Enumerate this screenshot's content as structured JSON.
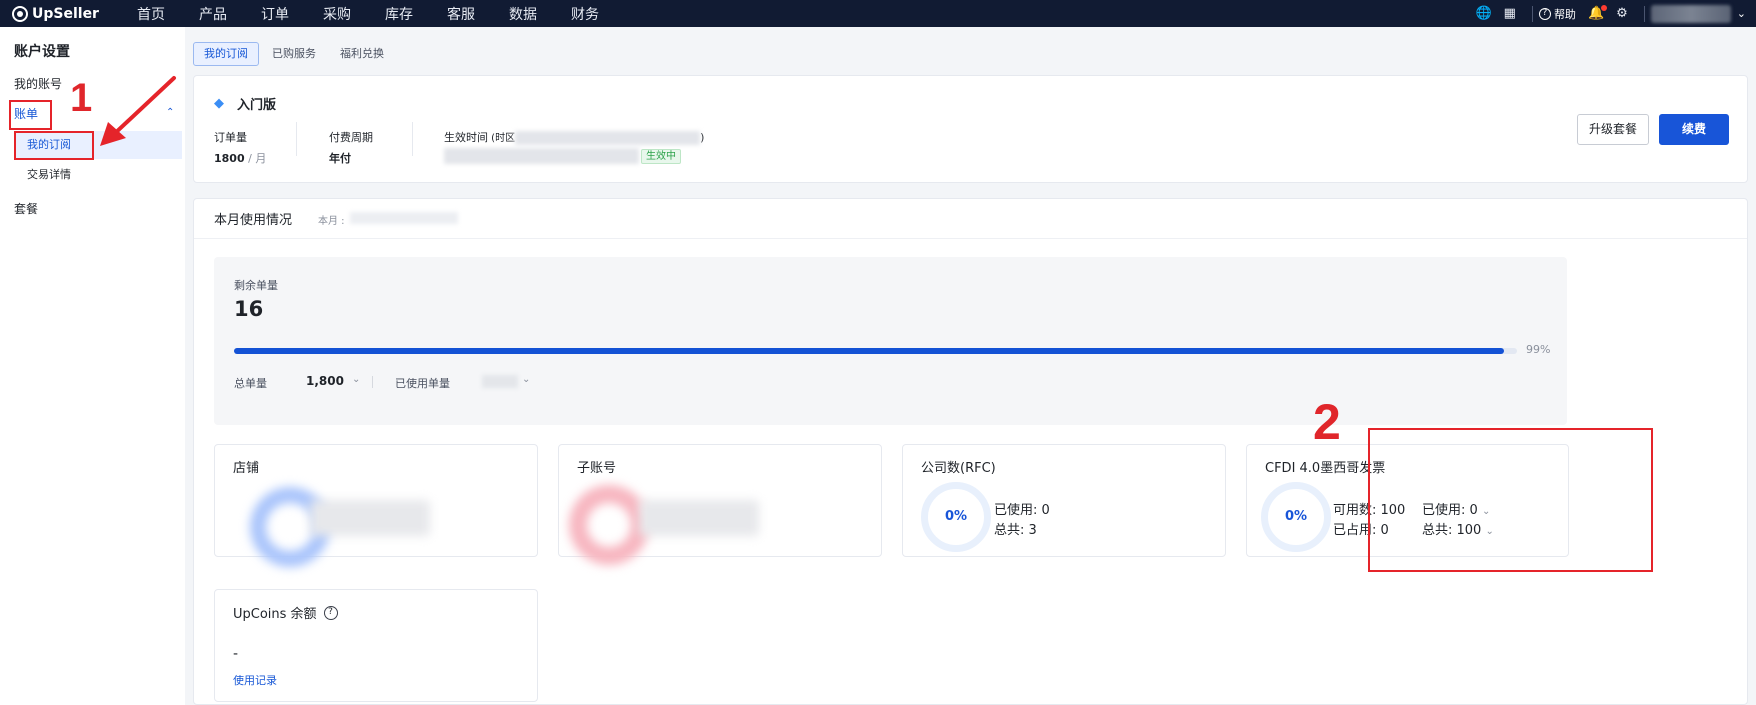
{
  "topbar": {
    "logo_text": "UpSeller",
    "nav": [
      "首页",
      "产品",
      "订单",
      "采购",
      "库存",
      "客服",
      "数据",
      "财务"
    ],
    "help_label": "帮助"
  },
  "sidebar": {
    "title": "账户设置",
    "items": {
      "my_account": "我的账号",
      "bill": "账单",
      "my_subscription": "我的订阅",
      "transactions": "交易详情",
      "plans": "套餐"
    }
  },
  "annotations": {
    "one": "1",
    "two": "2"
  },
  "tabs": [
    "我的订阅",
    "已购服务",
    "福利兑换"
  ],
  "plan": {
    "name": "入门版",
    "order_label": "订单量",
    "order_value": "1800",
    "order_unit": " / 月",
    "cycle_label": "付费周期",
    "cycle_value": "年付",
    "effective_label": "生效时间",
    "tz_prefix": " (时区",
    "tz_suffix": ")",
    "status_badge": "生效中",
    "upgrade_label": "升级套餐",
    "renew_label": "续费"
  },
  "usage": {
    "title": "本月使用情况",
    "month_label": "本月 :",
    "remaining_label": "剩余单量",
    "remaining_value": "16",
    "progress_pct": "99%",
    "progress_fraction": 0.99,
    "total_label": "总单量",
    "total_value": "1,800",
    "used_label": "已使用单量"
  },
  "metrics": {
    "shop": {
      "title": "店铺"
    },
    "subaccount": {
      "title": "子账号"
    },
    "company": {
      "title": "公司数(RFC)",
      "pct": "0%",
      "used": "已使用: 0",
      "total": "总共: 3"
    },
    "cfdi": {
      "title": "CFDI 4.0墨西哥发票",
      "pct": "0%",
      "available": "可用数: 100",
      "occupied": "已占用: 0",
      "used": "已使用: 0",
      "total": "总共: 100"
    }
  },
  "upcoins": {
    "title": "UpCoins 余额",
    "value": "-",
    "link": "使用记录"
  },
  "colors": {
    "nav_bg": "#111b33",
    "primary": "#1855d8",
    "annotation_red": "#e5242a",
    "success": "#2ca24a"
  }
}
